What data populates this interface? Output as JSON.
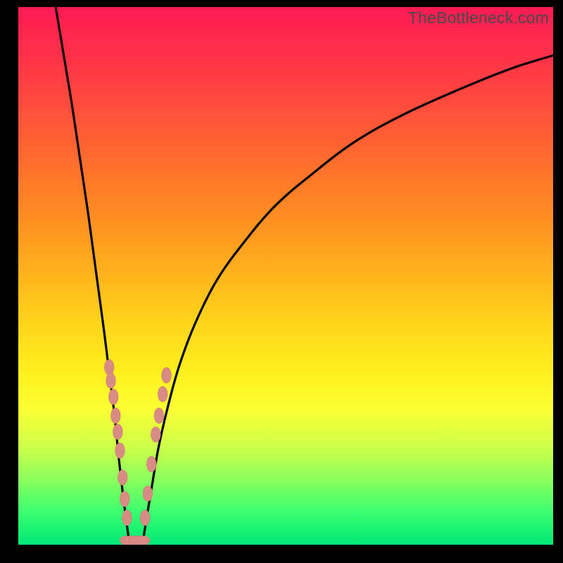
{
  "watermark_text": "TheBottleneck.com",
  "colors": {
    "frame": "#000000",
    "curve": "#000000",
    "marker_fill": "#db8b86",
    "marker_stroke": "#c77a74"
  },
  "chart_data": {
    "type": "line",
    "title": "",
    "xlabel": "",
    "ylabel": "",
    "xlim": [
      0,
      100
    ],
    "ylim": [
      0,
      100
    ],
    "grid": false,
    "legend": false,
    "series": [
      {
        "name": "left-curve",
        "x": [
          7.0,
          8.5,
          10.0,
          11.5,
          13.0,
          14.5,
          16.0,
          17.0,
          18.0,
          18.8,
          19.6,
          20.2,
          20.8
        ],
        "values": [
          100,
          91,
          82,
          72,
          62,
          51,
          40,
          32,
          24,
          16,
          9,
          4.5,
          0
        ]
      },
      {
        "name": "right-curve",
        "x": [
          23.2,
          24.0,
          25.0,
          26.2,
          27.8,
          30.0,
          33.0,
          37.0,
          42.0,
          48.0,
          55.0,
          63.0,
          72.0,
          82.0,
          92.0,
          100.0
        ],
        "values": [
          0,
          5,
          11,
          18,
          25,
          33,
          41,
          49,
          56,
          63,
          69,
          75,
          80,
          84.5,
          88.5,
          91
        ]
      }
    ],
    "markers": {
      "note": "approximate positions of salmon oval markers (x%, y%)",
      "points_left": [
        [
          17.0,
          33.0
        ],
        [
          17.3,
          30.5
        ],
        [
          17.8,
          27.5
        ],
        [
          18.2,
          24.0
        ],
        [
          18.6,
          21.0
        ],
        [
          19.0,
          17.5
        ],
        [
          19.5,
          12.5
        ],
        [
          19.9,
          8.5
        ],
        [
          20.3,
          5.0
        ]
      ],
      "points_right": [
        [
          23.7,
          5.0
        ],
        [
          24.2,
          9.5
        ],
        [
          24.9,
          15.0
        ],
        [
          25.7,
          20.5
        ],
        [
          26.3,
          24.0
        ],
        [
          27.0,
          28.0
        ],
        [
          27.7,
          31.5
        ]
      ],
      "points_bottom": [
        [
          20.2,
          0.8
        ],
        [
          21.0,
          0.8
        ],
        [
          21.8,
          0.8
        ],
        [
          22.6,
          0.8
        ],
        [
          23.4,
          0.8
        ]
      ]
    }
  }
}
